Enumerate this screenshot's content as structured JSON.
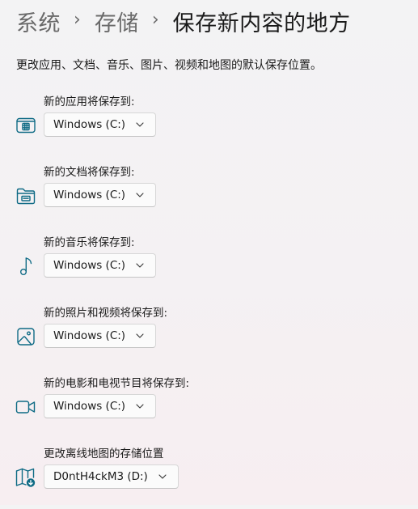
{
  "breadcrumb": {
    "items": [
      "系统",
      "存储",
      "保存新内容的地方"
    ]
  },
  "description": "更改应用、文档、音乐、图片、视频和地图的默认保存位置。",
  "groups": [
    {
      "label": "新的应用将保存到:",
      "value": "Windows (C:)",
      "icon": "apps-icon"
    },
    {
      "label": "新的文档将保存到:",
      "value": "Windows (C:)",
      "icon": "folder-document-icon"
    },
    {
      "label": "新的音乐将保存到:",
      "value": "Windows (C:)",
      "icon": "music-note-icon"
    },
    {
      "label": "新的照片和视频将保存到:",
      "value": "Windows (C:)",
      "icon": "image-icon"
    },
    {
      "label": "新的电影和电视节目将保存到:",
      "value": "Windows (C:)",
      "icon": "video-camera-icon"
    },
    {
      "label": "更改离线地图的存储位置",
      "value": "D0ntH4ckM3 (D:)",
      "icon": "map-download-icon"
    }
  ],
  "colors": {
    "accent": "#0f6b85",
    "accent_badge": "#0f6b85"
  }
}
